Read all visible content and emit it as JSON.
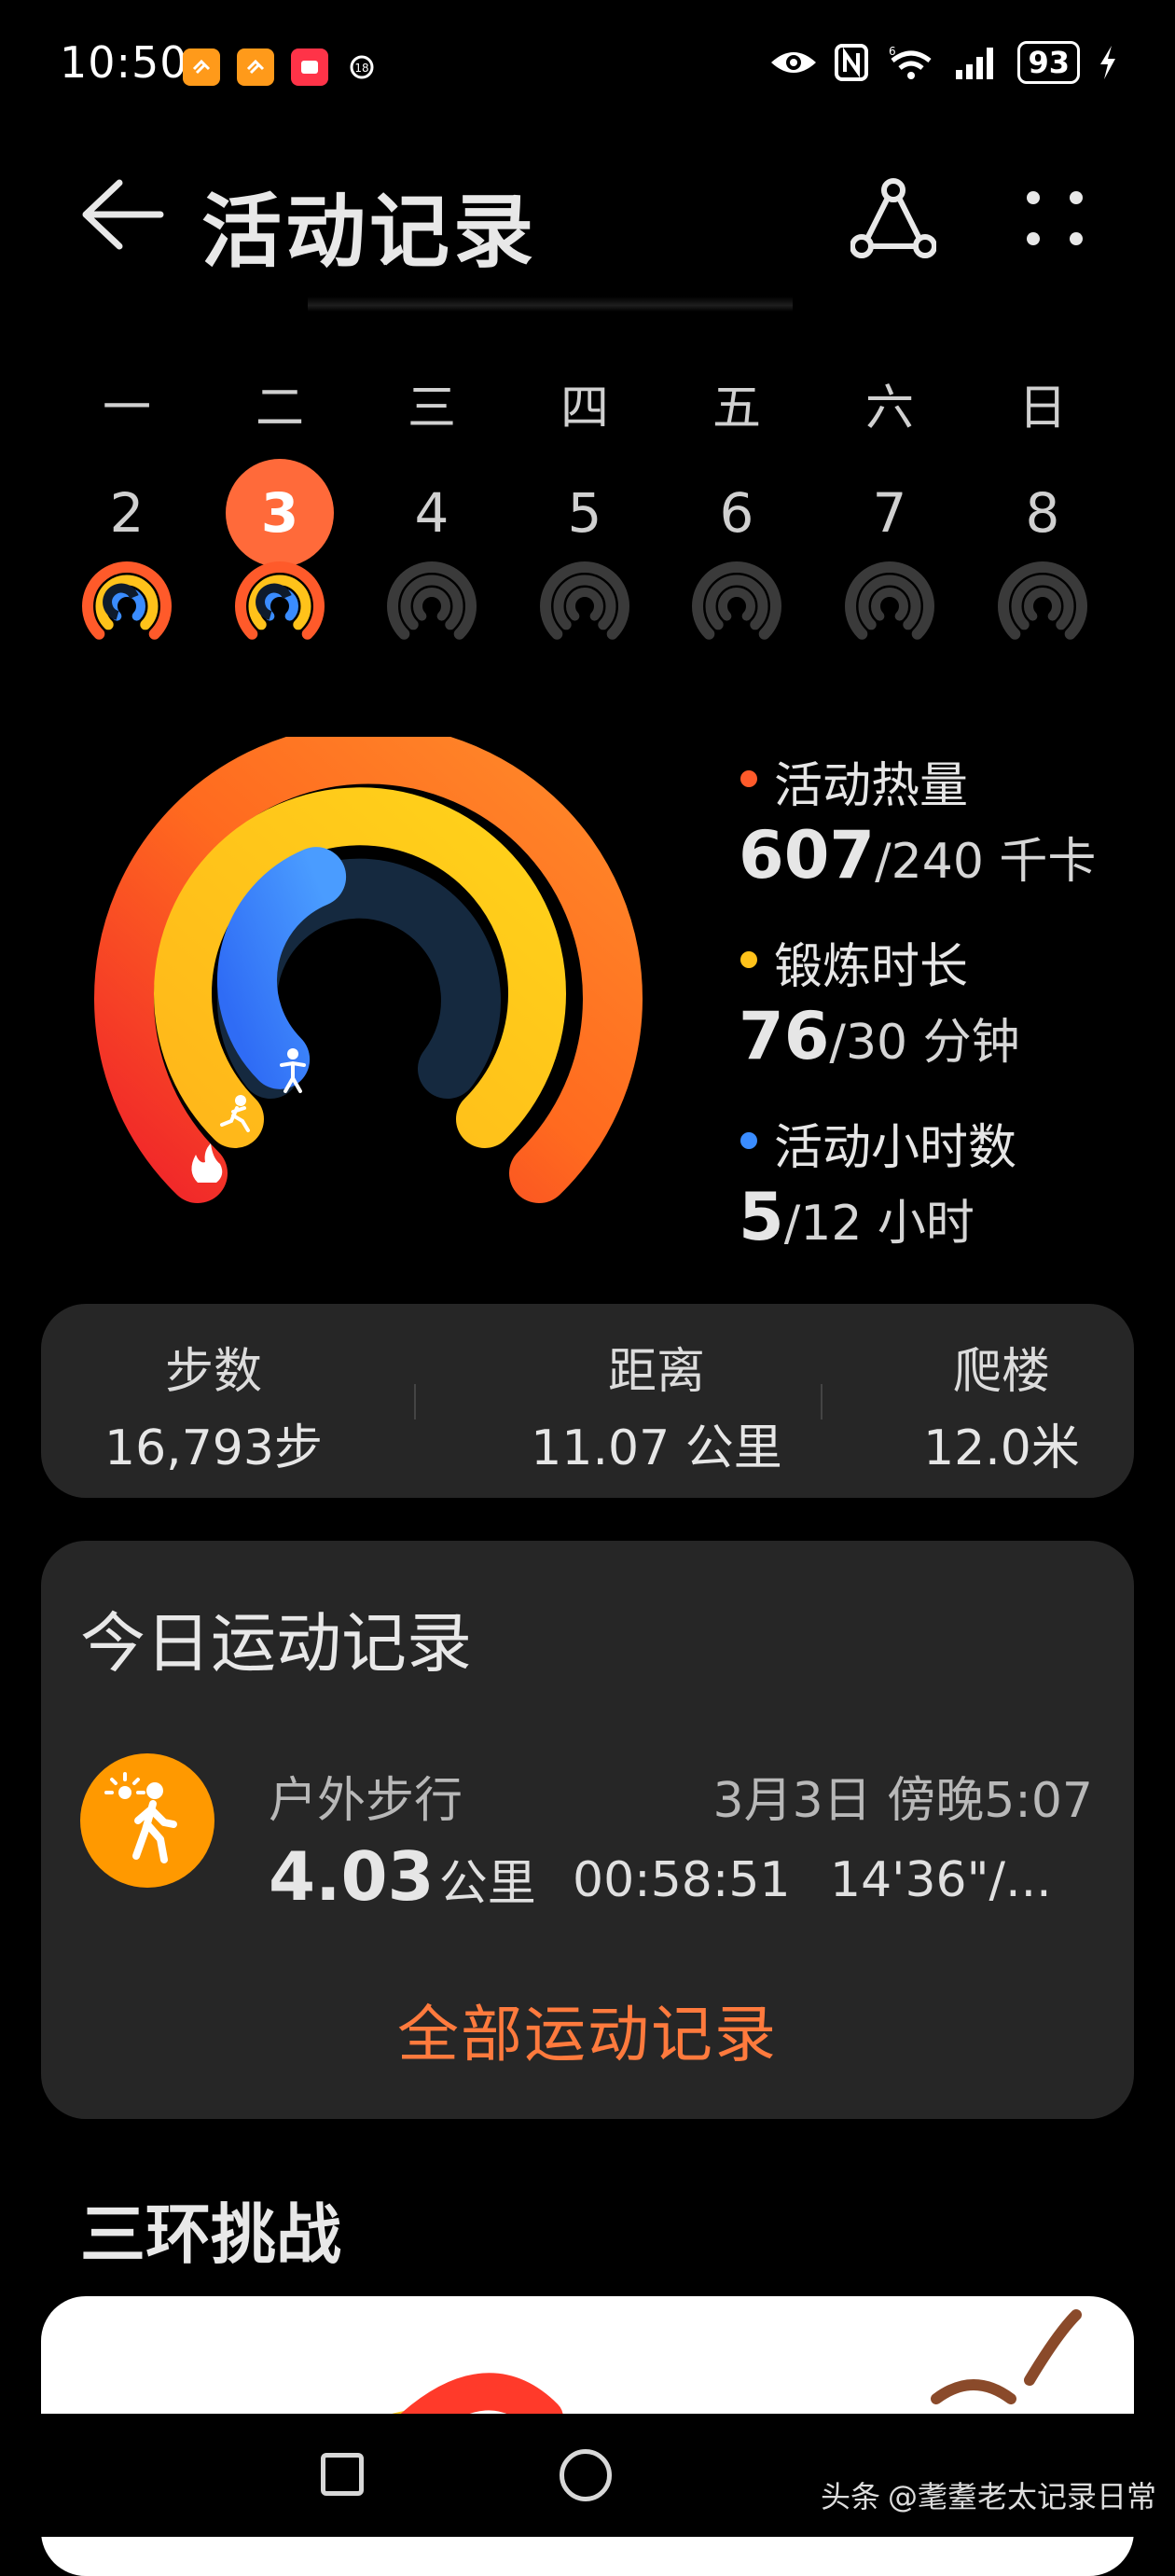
{
  "status_bar": {
    "time": "10:50",
    "battery": "93",
    "icons": [
      "eye-icon",
      "nfc-icon",
      "wifi-6-icon",
      "signal-icon",
      "battery-icon",
      "charging-icon"
    ],
    "notifications": [
      "app-orange-icon",
      "app-orange-icon",
      "app-red-icon",
      "app-badge-icon"
    ]
  },
  "header": {
    "title": "活动记录",
    "back_icon": "back-arrow-icon",
    "share_icon": "share-icon",
    "more_icon": "more-icon"
  },
  "week": {
    "days": [
      {
        "weekday": "一",
        "date": "2",
        "active": false,
        "filled": true
      },
      {
        "weekday": "二",
        "date": "3",
        "active": true,
        "filled": true
      },
      {
        "weekday": "三",
        "date": "4",
        "active": false,
        "filled": false
      },
      {
        "weekday": "四",
        "date": "5",
        "active": false,
        "filled": false
      },
      {
        "weekday": "五",
        "date": "6",
        "active": false,
        "filled": false
      },
      {
        "weekday": "六",
        "date": "7",
        "active": false,
        "filled": false
      },
      {
        "weekday": "日",
        "date": "8",
        "active": false,
        "filled": false
      }
    ]
  },
  "rings": {
    "colors": {
      "calories": "#ff5a2a",
      "exercise": "#ffc21a",
      "hours": "#3a8cff"
    },
    "calories": {
      "label": "活动热量",
      "value": "607",
      "goal": "/240 千卡"
    },
    "exercise": {
      "label": "锻炼时长",
      "value": "76",
      "goal": "/30 分钟"
    },
    "hours": {
      "label": "活动小时数",
      "value": "5",
      "goal": "/12 小时",
      "progress": 0.4167
    }
  },
  "stats": {
    "steps": {
      "label": "步数",
      "value": "16,793",
      "unit": "步"
    },
    "distance": {
      "label": "距离",
      "value": "11.07",
      "unit": "公里"
    },
    "floors": {
      "label": "爬楼",
      "value": "12.0",
      "unit": "米"
    }
  },
  "today": {
    "title": "今日运动记录",
    "exercise": {
      "type": "户外步行",
      "datetime": "3月3日 傍晚5:07",
      "distance": "4.03",
      "distance_unit": "公里",
      "duration": "00:58:51",
      "pace": "14'36\"/..."
    },
    "all_records": "全部运动记录"
  },
  "challenge": {
    "title": "三环挑战"
  },
  "watermark": {
    "brand": "头条",
    "text": "@耄耋老太记录日常"
  }
}
